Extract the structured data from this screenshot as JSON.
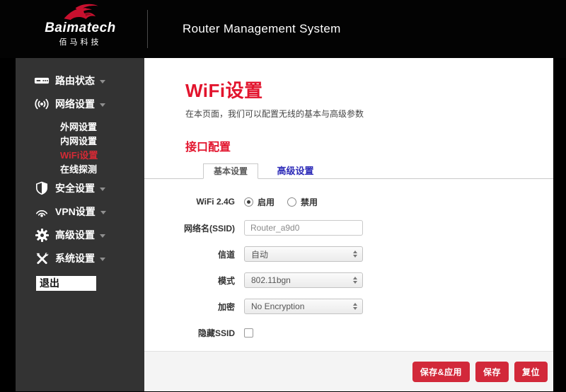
{
  "header": {
    "brand": "Baimatech",
    "brand_cn": "佰马科技",
    "title": "Router Management System"
  },
  "sidebar": {
    "items": [
      {
        "label": "路由状态",
        "icon": "router-icon"
      },
      {
        "label": "网络设置",
        "icon": "broadcast-icon",
        "children": [
          "外网设置",
          "内网设置",
          "WiFi设置",
          "在线探测"
        ],
        "active_child": "WiFi设置"
      },
      {
        "label": "安全设置",
        "icon": "shield-icon"
      },
      {
        "label": "VPN设置",
        "icon": "wireless-icon"
      },
      {
        "label": "高级设置",
        "icon": "gear-icon"
      },
      {
        "label": "系统设置",
        "icon": "tools-icon"
      }
    ],
    "logout_label": "退出"
  },
  "main": {
    "page_title": "WiFi设置",
    "page_subtitle": "在本页面，我们可以配置无线的基本与高级参数",
    "section_title": "接口配置",
    "tabs": [
      {
        "label": "基本设置",
        "active": true
      },
      {
        "label": "高级设置",
        "active": false
      }
    ],
    "form": {
      "wifi_label": "WiFi 2.4G",
      "enable_option": "启用",
      "disable_option": "禁用",
      "wifi_selected": "启用",
      "ssid_label": "网络名(SSID)",
      "ssid_value": "Router_a9d0",
      "channel_label": "信道",
      "channel_value": "自动",
      "mode_label": "模式",
      "mode_value": "802.11bgn",
      "encryption_label": "加密",
      "encryption_value": "No Encryption",
      "hide_ssid_label": "隐藏SSID",
      "hide_ssid_checked": false
    },
    "footer_buttons": [
      {
        "label": "保存&应用"
      },
      {
        "label": "保存"
      },
      {
        "label": "复位"
      }
    ]
  },
  "colors": {
    "heading_red": "#e2142d",
    "button_red": "#d2293a",
    "active_item_red": "#d42a35",
    "link_blue": "#2d2bb8",
    "sidebar_bg": "#333333",
    "header_bg": "#030303"
  }
}
